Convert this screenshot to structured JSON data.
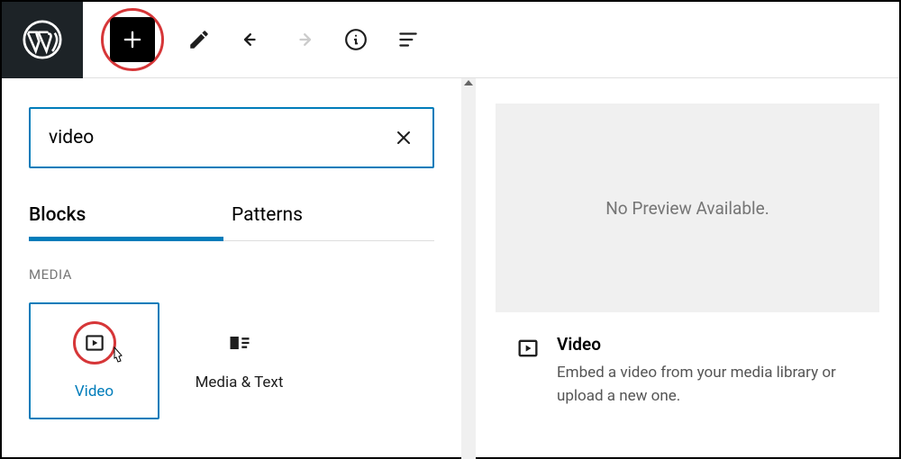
{
  "search": {
    "value": "video"
  },
  "tabs": {
    "blocks": "Blocks",
    "patterns": "Patterns"
  },
  "category": "MEDIA",
  "blocks": [
    {
      "label": "Video"
    },
    {
      "label": "Media & Text"
    }
  ],
  "preview": {
    "empty": "No Preview Available."
  },
  "detail": {
    "title": "Video",
    "description": "Embed a video from your media library or upload a new one."
  }
}
